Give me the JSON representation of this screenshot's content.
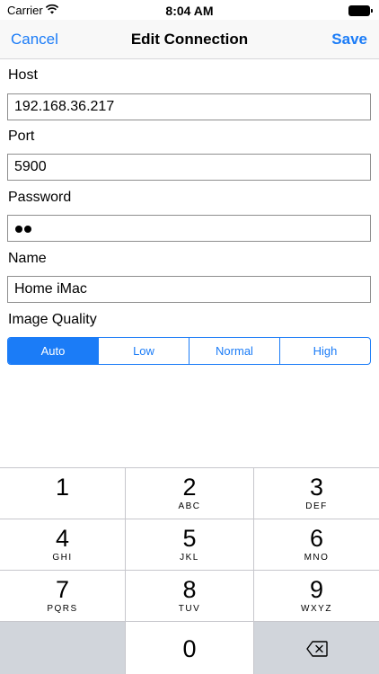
{
  "status_bar": {
    "carrier": "Carrier",
    "time": "8:04 AM",
    "wifi_icon": "wifi-icon",
    "battery_icon": "battery-icon"
  },
  "nav": {
    "cancel_label": "Cancel",
    "title": "Edit Connection",
    "save_label": "Save"
  },
  "form": {
    "host": {
      "label": "Host",
      "value": "192.168.36.217"
    },
    "port": {
      "label": "Port",
      "value": "5900"
    },
    "password": {
      "label": "Password",
      "masked_length": 2
    },
    "name": {
      "label": "Name",
      "value": "Home iMac"
    },
    "image_quality": {
      "label": "Image Quality",
      "options": [
        "Auto",
        "Low",
        "Normal",
        "High"
      ],
      "selected": "Auto"
    }
  },
  "keypad": {
    "keys": [
      {
        "num": "1",
        "letters": ""
      },
      {
        "num": "2",
        "letters": "ABC"
      },
      {
        "num": "3",
        "letters": "DEF"
      },
      {
        "num": "4",
        "letters": "GHI"
      },
      {
        "num": "5",
        "letters": "JKL"
      },
      {
        "num": "6",
        "letters": "MNO"
      },
      {
        "num": "7",
        "letters": "PQRS"
      },
      {
        "num": "8",
        "letters": "TUV"
      },
      {
        "num": "9",
        "letters": "WXYZ"
      },
      {
        "num": "0",
        "letters": ""
      }
    ],
    "delete_icon": "backspace-icon"
  },
  "colors": {
    "accent": "#1b7cf7",
    "keypad_gray": "#d1d5db"
  }
}
